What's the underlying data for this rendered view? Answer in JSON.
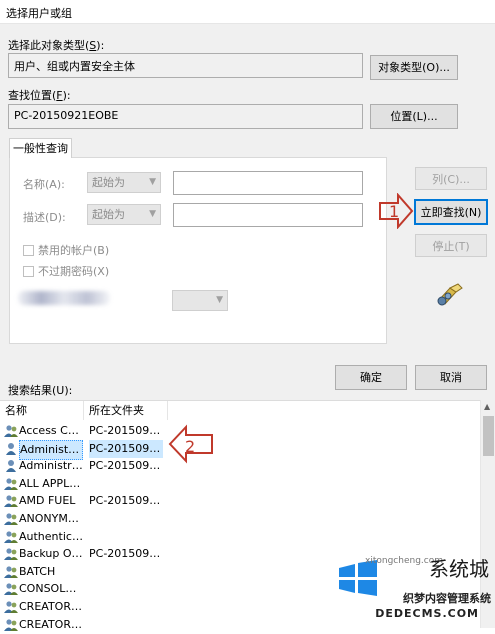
{
  "window": {
    "title": "选择用户或组"
  },
  "object_type": {
    "label": "选择此对象类型(",
    "key": "S",
    "label_end": "):",
    "value": "用户、组或内置安全主体",
    "button": "对象类型(O)..."
  },
  "location": {
    "label": "查找位置(",
    "key": "F",
    "label_end": "):",
    "value": "PC-20150921EOBE",
    "button": "位置(L)..."
  },
  "tab": {
    "label": "一般性查询"
  },
  "query": {
    "name_label": "名称(A):",
    "name_op": "起始为",
    "desc_label": "描述(D):",
    "desc_op": "起始为",
    "disabled_accounts": "禁用的帐户(B)",
    "non_expiring": "不过期密码(X)"
  },
  "buttons": {
    "columns": "列(C)...",
    "find_now": "立即查找(N)",
    "stop": "停止(T)",
    "ok": "确定",
    "cancel": "取消"
  },
  "results": {
    "label": "搜索结果(U):",
    "columns": [
      "名称",
      "所在文件夹"
    ],
    "rows": [
      {
        "name": "Access Con...",
        "folder": "PC-20150921..."
      },
      {
        "name": "Administrat...",
        "folder": "PC-20150921...",
        "selected": true
      },
      {
        "name": "Administrat...",
        "folder": "PC-20150921..."
      },
      {
        "name": "ALL APPLIC...",
        "folder": ""
      },
      {
        "name": "AMD FUEL",
        "folder": "PC-20150921..."
      },
      {
        "name": "ANONYMO...",
        "folder": ""
      },
      {
        "name": "Authenticat...",
        "folder": ""
      },
      {
        "name": "Backup Op...",
        "folder": "PC-20150921..."
      },
      {
        "name": "BATCH",
        "folder": ""
      },
      {
        "name": "CONSOLE ...",
        "folder": ""
      },
      {
        "name": "CREATOR ...",
        "folder": ""
      },
      {
        "name": "CREATOR ...",
        "folder": ""
      }
    ]
  },
  "annotations": {
    "step1": "1",
    "step2": "2"
  },
  "watermark": {
    "brand": "系统城",
    "url": "xitongcheng.com",
    "sub": "织梦内容管理系统",
    "domain": "DEDECMS.COM"
  },
  "colors": {
    "accent": "#0078d7",
    "callout": "#c0392b",
    "selection": "#cce8ff"
  },
  "icons": {
    "user": "user-icon",
    "group": "group-icon",
    "find": "binoculars-icon"
  }
}
